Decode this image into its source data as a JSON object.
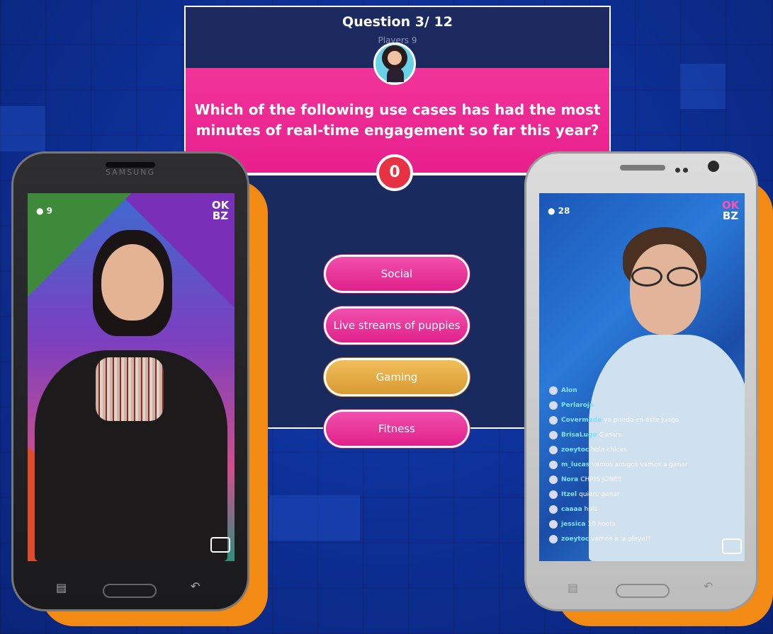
{
  "quiz": {
    "title": "Question 3/ 12",
    "players": "Players 9",
    "question": "Which of the following use cases has had the most minutes of real-time engagement so far this year?",
    "timer": "0",
    "answers": [
      {
        "label": "Social",
        "state": "default"
      },
      {
        "label": "Live streams of puppies",
        "state": "default"
      },
      {
        "label": "Gaming",
        "state": "highlighted"
      },
      {
        "label": "Fitness",
        "state": "default"
      }
    ]
  },
  "left_phone": {
    "brand": "SAMSUNG",
    "viewers": "9",
    "logo": [
      "OK",
      "BZ"
    ],
    "icons": [
      "menu-icon",
      "home-button",
      "back-icon",
      "chat-icon"
    ]
  },
  "right_phone": {
    "viewers": "28",
    "logo": [
      "OK",
      "BZ"
    ],
    "chat": [
      {
        "user": "Alon",
        "text": ""
      },
      {
        "user": "Perlaroja",
        "text": ""
      },
      {
        "user": "Covermada",
        "text": "yo puedo en este juego"
      },
      {
        "user": "BrisaLugo",
        "text": "Ganare"
      },
      {
        "user": "zoeytoc",
        "text": "hola chicas"
      },
      {
        "user": "m_lucas",
        "text": "vamos amigos vamos a ganar"
      },
      {
        "user": "Nora",
        "text": "CHRIS JONES"
      },
      {
        "user": "Itzel",
        "text": "quiero ganar"
      },
      {
        "user": "caaaa",
        "text": "hola"
      },
      {
        "user": "jessica",
        "text": "10 hoots"
      },
      {
        "user": "zoeytoc",
        "text": "vamos a la playa!!"
      }
    ]
  },
  "colors": {
    "background": "#0d2f95",
    "pink": "#e81f8c",
    "gold": "#e0a43c",
    "timer": "#e63243",
    "phone_shadow": "#f28a14"
  }
}
